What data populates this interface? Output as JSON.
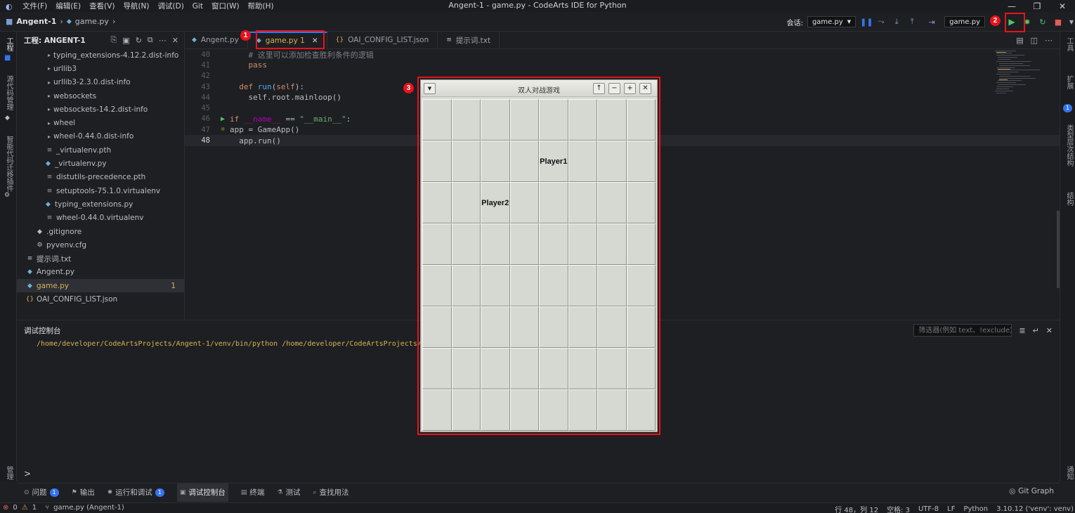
{
  "menubar": {
    "items": [
      "文件(F)",
      "编辑(E)",
      "查看(V)",
      "导航(N)",
      "调试(D)",
      "Git",
      "窗口(W)",
      "帮助(H)"
    ],
    "window_title": "Angent-1 - game.py - CodeArts IDE for Python"
  },
  "toolbar": {
    "project": "Angent-1",
    "file": "game.py",
    "session_label": "会话:",
    "session_value": "game.py",
    "run_config": "game.py"
  },
  "left_bar": {
    "explorer_label": "工程",
    "scm_label": "源代码管理",
    "migrate_label": "智能代码迁移插件",
    "bottom_label": "管理"
  },
  "right_bar": {
    "tools_label": "工具",
    "ext_label": "扩展",
    "ext_count": "1",
    "type_label": "类型层次结构",
    "struct_label": "结构",
    "notify_label": "通知"
  },
  "explorer": {
    "title": "工程: ANGENT-1",
    "items": [
      {
        "label": "typing_extensions-4.12.2.dist-info",
        "kind": "folder"
      },
      {
        "label": "urllib3",
        "kind": "folder"
      },
      {
        "label": "urllib3-2.3.0.dist-info",
        "kind": "folder"
      },
      {
        "label": "websockets",
        "kind": "folder"
      },
      {
        "label": "websockets-14.2.dist-info",
        "kind": "folder"
      },
      {
        "label": "wheel",
        "kind": "folder"
      },
      {
        "label": "wheel-0.44.0.dist-info",
        "kind": "folder"
      },
      {
        "label": "_virtualenv.pth",
        "kind": "file"
      },
      {
        "label": "_virtualenv.py",
        "kind": "py"
      },
      {
        "label": "distutils-precedence.pth",
        "kind": "file"
      },
      {
        "label": "setuptools-75.1.0.virtualenv",
        "kind": "file"
      },
      {
        "label": "typing_extensions.py",
        "kind": "py"
      },
      {
        "label": "wheel-0.44.0.virtualenv",
        "kind": "file"
      },
      {
        "label": ".gitignore",
        "kind": "git"
      },
      {
        "label": "pyvenv.cfg",
        "kind": "cfg"
      },
      {
        "label": "提示词.txt",
        "kind": "txt"
      },
      {
        "label": "Angent.py",
        "kind": "py"
      },
      {
        "label": "game.py",
        "kind": "py",
        "active": true,
        "badge": "1"
      },
      {
        "label": "OAI_CONFIG_LIST.json",
        "kind": "json"
      }
    ]
  },
  "tabs": [
    {
      "label": "Angent.py",
      "icon": "py"
    },
    {
      "label": "game.py 1",
      "icon": "py",
      "active": true
    },
    {
      "label": "OAI_CONFIG_LIST.json",
      "icon": "json"
    },
    {
      "label": "提示词.txt",
      "icon": "txt"
    }
  ],
  "editor": {
    "lines": [
      {
        "n": "40",
        "code": [
          [
            "cm",
            "    # 这里可以添加检查胜利条件的逻辑"
          ]
        ]
      },
      {
        "n": "41",
        "code": [
          [
            "kw",
            "    pass"
          ]
        ]
      },
      {
        "n": "42",
        "code": []
      },
      {
        "n": "43",
        "code": [
          [
            "kw",
            "  def "
          ],
          [
            "fn",
            "run"
          ],
          [
            "",
            "("
          ],
          [
            "kw",
            "self"
          ],
          [
            "",
            "):"
          ]
        ]
      },
      {
        "n": "44",
        "code": [
          [
            "",
            "    self.root.mainloop()"
          ]
        ]
      },
      {
        "n": "45",
        "code": []
      },
      {
        "n": "46",
        "code": [
          [
            "kw",
            "if "
          ],
          [
            "sp",
            "__name__"
          ],
          [
            "",
            " == "
          ],
          [
            "str",
            "\"__main__\""
          ],
          [
            "",
            ":"
          ]
        ]
      },
      {
        "n": "47",
        "code": [
          [
            "",
            "app = GameApp()"
          ]
        ]
      },
      {
        "n": "48",
        "code": [
          [
            "",
            "  app.run()"
          ]
        ]
      }
    ]
  },
  "console": {
    "title": "调试控制台",
    "filter_placeholder": "筛选器(例如 text、!exclude)",
    "output": "/home/developer/CodeArtsProjects/Angent-1/venv/bin/python /home/developer/CodeArtsProjects/Angent-1/game.py",
    "prompt": ">"
  },
  "panel_tabs": [
    {
      "label": "问题",
      "count": "1"
    },
    {
      "label": "输出"
    },
    {
      "label": "运行和调试",
      "count": "1"
    },
    {
      "label": "调试控制台",
      "active": true
    },
    {
      "label": "终端"
    },
    {
      "label": "测试"
    },
    {
      "label": "查找用法"
    }
  ],
  "git_graph": "Git Graph",
  "statusbar": {
    "errors": "0",
    "warnings": "1",
    "file": "game.py (Angent-1)",
    "position": "行 48，列 12",
    "spaces": "空格: 3",
    "encoding": "UTF-8",
    "eol": "LF",
    "language": "Python",
    "interpreter": "3.10.12 ('venv': venv)"
  },
  "game": {
    "title": "双人对战游戏",
    "rows": 8,
    "cols": 8,
    "pieces": [
      {
        "row": 1,
        "col": 4,
        "label": "Player1"
      },
      {
        "row": 2,
        "col": 2,
        "label": "Player2"
      }
    ]
  },
  "annotations": [
    "1",
    "2",
    "3"
  ]
}
